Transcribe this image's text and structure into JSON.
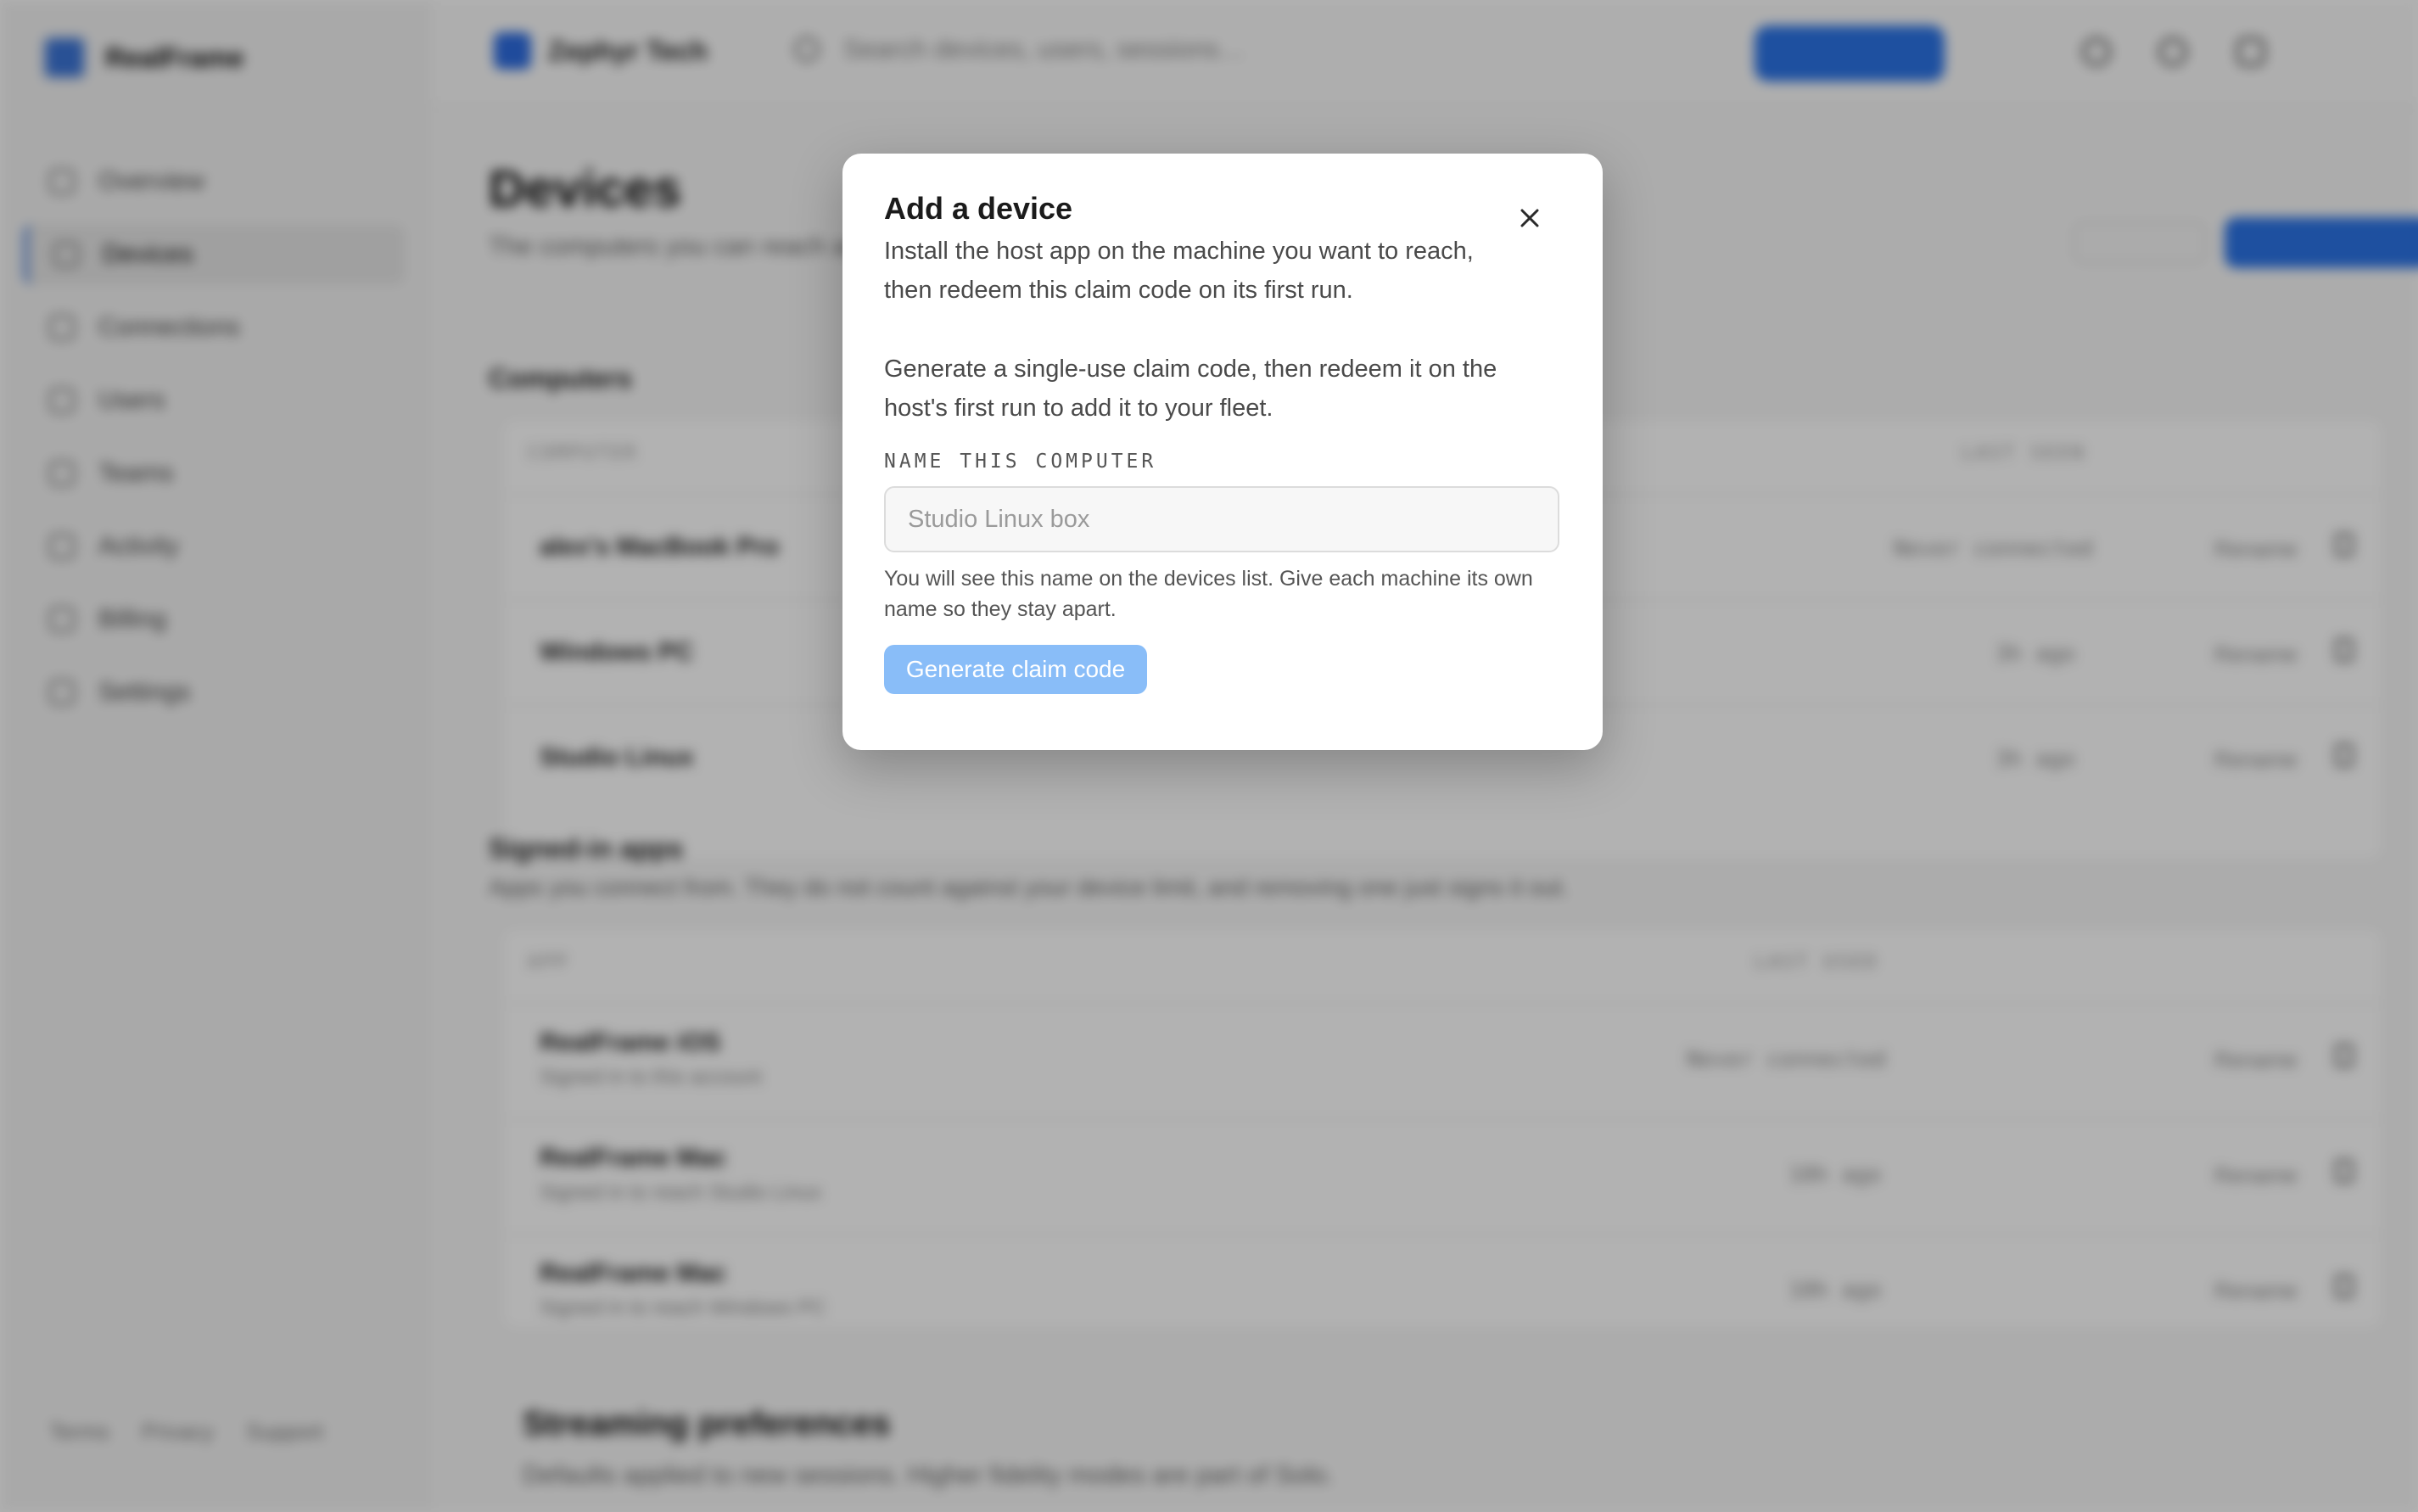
{
  "colors": {
    "accent": "#2b73e6",
    "disabled_button": "#89bdf8",
    "scrim": "rgba(0,0,0,0.30)"
  },
  "modal": {
    "title": "Add a device",
    "description": "Install the host app on the machine you want to reach, then redeem this claim code on its first run.",
    "body": "Generate a single-use claim code, then redeem it on the host's first run to add it to your fleet.",
    "field_label": "NAME THIS COMPUTER",
    "field_placeholder": "Studio Linux box",
    "field_value": "",
    "field_help": "You will see this name on the devices list. Give each machine its own name so they stay apart.",
    "submit_label": "Generate claim code",
    "close_icon": "close-icon"
  },
  "background": {
    "brand": "RealFrame",
    "nav": [
      "Overview",
      "Devices",
      "Connections",
      "Users",
      "Teams",
      "Activity",
      "Billing",
      "Settings"
    ],
    "org": "Zephyr Tech",
    "search_placeholder": "Search devices, users, sessions…",
    "page_title": "Devices",
    "page_subtitle": "The computers you can reach and the apps you connect from.",
    "computers": {
      "title": "Computers",
      "columns": [
        "COMPUTER",
        "LAST SEEN"
      ],
      "rows": [
        {
          "name": "alex's MacBook Pro",
          "last": "Never connected",
          "action": "Rename"
        },
        {
          "name": "Windows PC",
          "last": "3h ago",
          "action": "Rename"
        },
        {
          "name": "Studio Linux",
          "last": "3h ago",
          "action": "Rename"
        }
      ]
    },
    "apps": {
      "title": "Signed-in apps",
      "subtitle": "Apps you connect from. They do not count against your device limit, and removing one just signs it out.",
      "columns": [
        "APP",
        "LAST USED"
      ],
      "rows": [
        {
          "name": "RealFrame iOS",
          "sub": "Signed in to this account",
          "last": "Never connected",
          "action": "Rename"
        },
        {
          "name": "RealFrame Mac",
          "sub": "Signed in to reach Studio Linux",
          "last": "10h ago",
          "action": "Rename"
        },
        {
          "name": "RealFrame Mac",
          "sub": "Signed in to reach Windows PC",
          "last": "10h ago",
          "action": "Rename"
        }
      ]
    },
    "streaming": {
      "title": "Streaming preferences",
      "subtitle": "Defaults applied to new sessions. Higher fidelity modes are part of Solo."
    },
    "footer_links": [
      "Terms",
      "Privacy",
      "Support"
    ]
  }
}
